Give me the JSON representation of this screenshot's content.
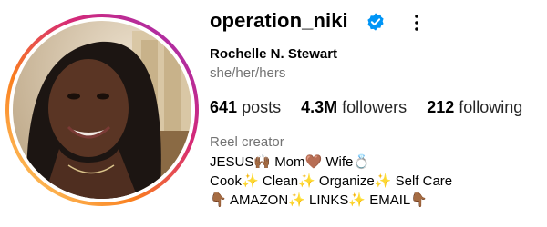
{
  "profile": {
    "username": "operation_niki",
    "verified_icon": "verified-badge-icon",
    "options_icon": "more-options-icon",
    "full_name": "Rochelle N. Stewart",
    "pronouns": "she/her/hers",
    "colors": {
      "verified_blue": "#0095f6",
      "ring_yellow": "#feda75",
      "ring_orange": "#fa7e1e",
      "ring_pink": "#d62976",
      "ring_purple": "#962fbf",
      "muted_text": "#737373"
    }
  },
  "stats": {
    "posts_count": "641",
    "posts_label": "posts",
    "followers_count": "4.3M",
    "followers_label": "followers",
    "following_count": "212",
    "following_label": "following"
  },
  "bio": {
    "category": "Reel creator",
    "line1": "JESUS🙌🏾 Mom🤎 Wife💍",
    "line2": "Cook✨ Clean✨ Organize✨ Self Care",
    "line3": "👇🏾 AMAZON✨ LINKS✨ EMAIL👇🏾"
  }
}
